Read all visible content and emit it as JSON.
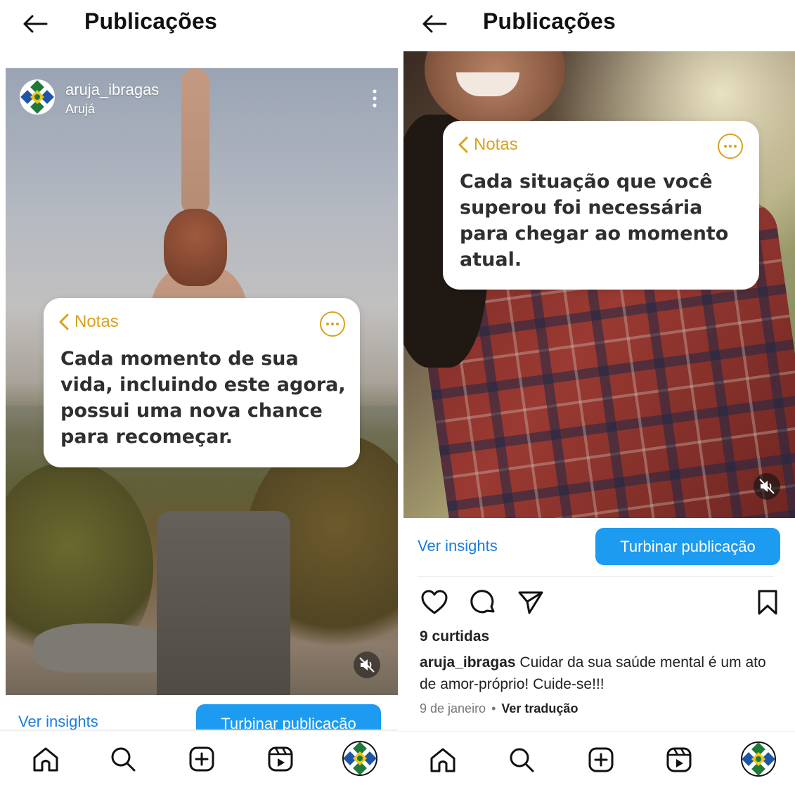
{
  "left_panel": {
    "header": {
      "title": "Publicações"
    },
    "post": {
      "username": "aruja_ibragas",
      "location": "Arujá",
      "note": {
        "back_label": "Notas",
        "text": "Cada momento de sua vida, incluindo este agora, possui uma nova chance para recomeçar."
      }
    },
    "actions": {
      "insights": "Ver insights",
      "boost": "Turbinar publicação"
    },
    "bottom_nav": [
      "home-icon",
      "search-icon",
      "create-icon",
      "reels-icon",
      "profile-avatar"
    ]
  },
  "right_panel": {
    "header": {
      "title": "Publicações"
    },
    "post": {
      "note": {
        "back_label": "Notas",
        "text": "Cada situação que você superou foi necessária para chegar ao momento atual."
      },
      "likes": "9 curtidas",
      "caption_username": "aruja_ibragas",
      "caption_text": "Cuidar da sua saúde mental é um ato de amor-próprio! Cuide-se!!!",
      "date": "9 de janeiro",
      "separator": "•",
      "translate": "Ver tradução"
    },
    "actions": {
      "insights": "Ver insights",
      "boost": "Turbinar publicação"
    },
    "bottom_nav": [
      "home-icon",
      "search-icon",
      "create-icon",
      "reels-icon",
      "profile-avatar"
    ]
  },
  "colors": {
    "accent_blue": "#1d9bf0",
    "link_blue": "#1a7ddb",
    "notes_gold": "#d9a21e"
  }
}
